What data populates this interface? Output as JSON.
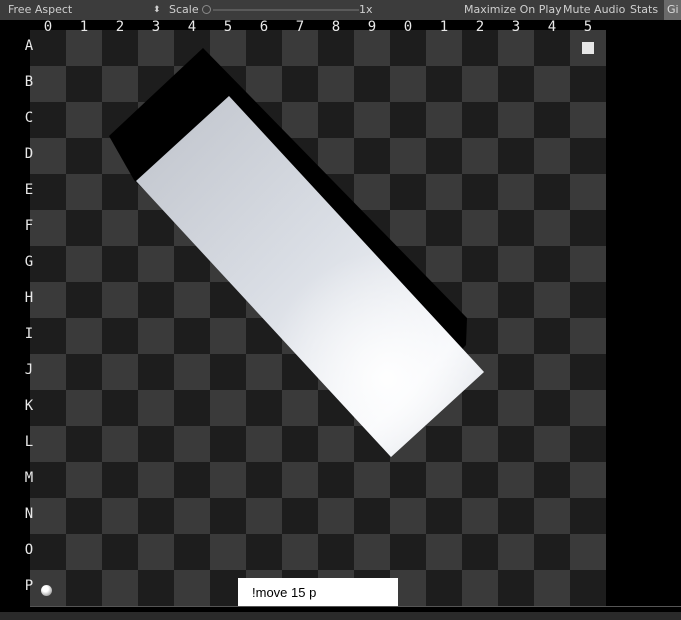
{
  "toolbar": {
    "aspect": "Free Aspect",
    "arrows": "⬍",
    "scale_label": "Scale",
    "scale_value": "1x",
    "maximize": "Maximize On Play",
    "mute": "Mute Audio",
    "stats": "Stats",
    "gizmos": "Gi"
  },
  "board": {
    "columns": [
      "0",
      "1",
      "2",
      "3",
      "4",
      "5",
      "6",
      "7",
      "8",
      "9",
      "0",
      "1",
      "2",
      "3",
      "4",
      "5"
    ],
    "rows": [
      "A",
      "B",
      "C",
      "D",
      "E",
      "F",
      "G",
      "H",
      "I",
      "J",
      "K",
      "L",
      "M",
      "N",
      "O",
      "P"
    ]
  },
  "command": {
    "value": "!move 15 p"
  }
}
